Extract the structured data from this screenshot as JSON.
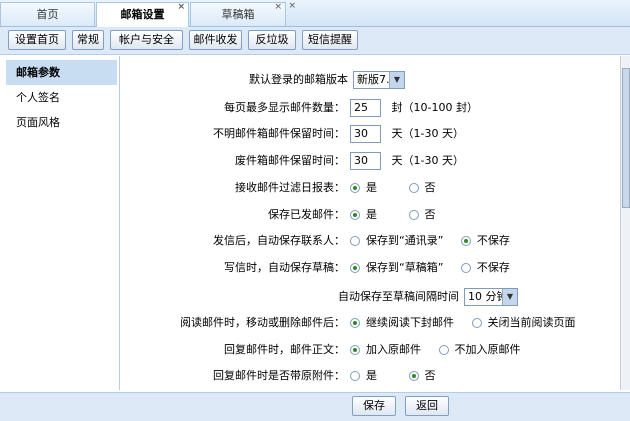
{
  "tabs": [
    {
      "label": "首页",
      "close": ""
    },
    {
      "label": "邮箱设置",
      "close": "×"
    },
    {
      "label": "草稿箱",
      "close": "×"
    },
    {
      "label": "",
      "close": "×"
    }
  ],
  "toolbar": [
    "设置首页",
    "常规",
    "帐户与安全",
    "邮件收发",
    "反垃圾",
    "短信提醒"
  ],
  "sidebar": [
    "邮箱参数",
    "个人签名",
    "页面风格"
  ],
  "settings": {
    "version": {
      "label": "默认登录的邮箱版本",
      "value": "新版7.1"
    },
    "per_page": {
      "label": "每页最多显示邮件数量：",
      "value": "25",
      "suffix": "封（10-100 封）"
    },
    "unknown_keep": {
      "label": "不明邮件箱邮件保留时间：",
      "value": "30",
      "suffix": "天（1-30 天）"
    },
    "trash_keep": {
      "label": "废件箱邮件保留时间：",
      "value": "30",
      "suffix": "天（1-30 天）"
    },
    "filter_report": {
      "label": "接收邮件过滤日报表：",
      "opt1": "是",
      "opt2": "否"
    },
    "save_sent": {
      "label": "保存已发邮件：",
      "opt1": "是",
      "opt2": "否"
    },
    "save_contact": {
      "label": "发信后，自动保存联系人：",
      "opt1": "保存到“通讯录”",
      "opt2": "不保存"
    },
    "save_draft": {
      "label": "写信时，自动保存草稿：",
      "opt1": "保存到“草稿箱”",
      "opt2": "不保存"
    },
    "draft_interval": {
      "label": "自动保存至草稿间隔时间",
      "value": "10 分钟"
    },
    "after_move": {
      "label": "阅读邮件时，移动或删除邮件后：",
      "opt1": "继续阅读下封邮件",
      "opt2": "关闭当前阅读页面"
    },
    "reply_body": {
      "label": "回复邮件时，邮件正文：",
      "opt1": "加入原邮件",
      "opt2": "不加入原邮件"
    },
    "reply_attach": {
      "label": "回复邮件时是否带原附件：",
      "opt1": "是",
      "opt2": "否"
    }
  },
  "buttons": {
    "save": "保存",
    "back": "返回"
  }
}
